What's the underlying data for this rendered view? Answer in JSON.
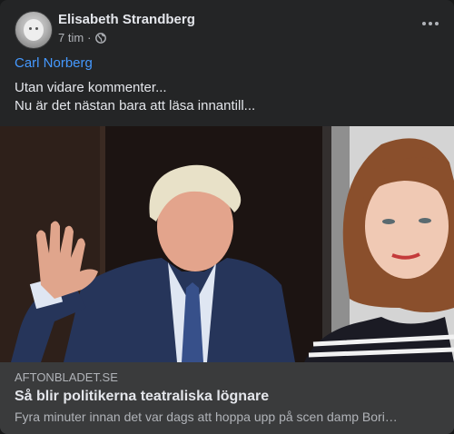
{
  "post": {
    "author": "Elisabeth Strandberg",
    "time": "7 tim",
    "separator": "·",
    "mention": "Carl Norberg",
    "text_line1": "Utan vidare kommenter...",
    "text_line2": "Nu är det nästan bara att läsa innantill..."
  },
  "link": {
    "domain": "AFTONBLADET.SE",
    "title": "Så blir politikerna teatraliska lögnare",
    "description": "Fyra minuter innan det var dags att hoppa upp på scen damp Bori…"
  },
  "icons": {
    "privacy": "globe-icon",
    "more": "more-horizontal-icon"
  },
  "colors": {
    "card_background": "#242526",
    "link_preview_background": "#3a3b3c",
    "mention": "#4599ff",
    "primary_text": "#e4e6eb",
    "secondary_text": "#b0b3b8"
  }
}
